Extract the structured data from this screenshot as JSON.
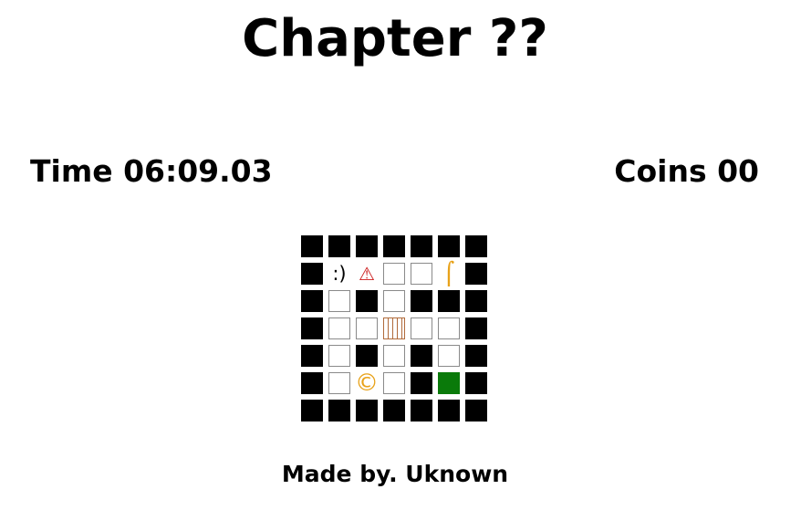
{
  "title": "Chapter ??",
  "time_label": "Time 06:09.03",
  "coins_label": "Coins 00",
  "footer": "Made by. Uknown",
  "colors": {
    "wall": "#000000",
    "goal": "#0a7a0a",
    "trap": "#cc1a1a",
    "key": "#e8a21a",
    "coin": "#e8a21a",
    "gate": "#b06a3a"
  },
  "board": {
    "rows": [
      [
        "wall",
        "wall",
        "wall",
        "wall",
        "wall",
        "wall",
        "wall"
      ],
      [
        "wall",
        "player",
        "trap",
        "floor",
        "floor",
        "key",
        "wall"
      ],
      [
        "wall",
        "floor",
        "wall",
        "floor",
        "wall",
        "wall",
        "wall"
      ],
      [
        "wall",
        "floor",
        "floor",
        "gate",
        "floor",
        "floor",
        "wall"
      ],
      [
        "wall",
        "floor",
        "wall",
        "floor",
        "wall",
        "floor",
        "wall"
      ],
      [
        "wall",
        "floor",
        "coin",
        "floor",
        "wall",
        "goal",
        "wall"
      ],
      [
        "wall",
        "wall",
        "wall",
        "wall",
        "wall",
        "wall",
        "wall"
      ]
    ],
    "glyphs": {
      "player": ":)",
      "trap": "⚠",
      "key": "⌠",
      "coin": "©"
    }
  }
}
